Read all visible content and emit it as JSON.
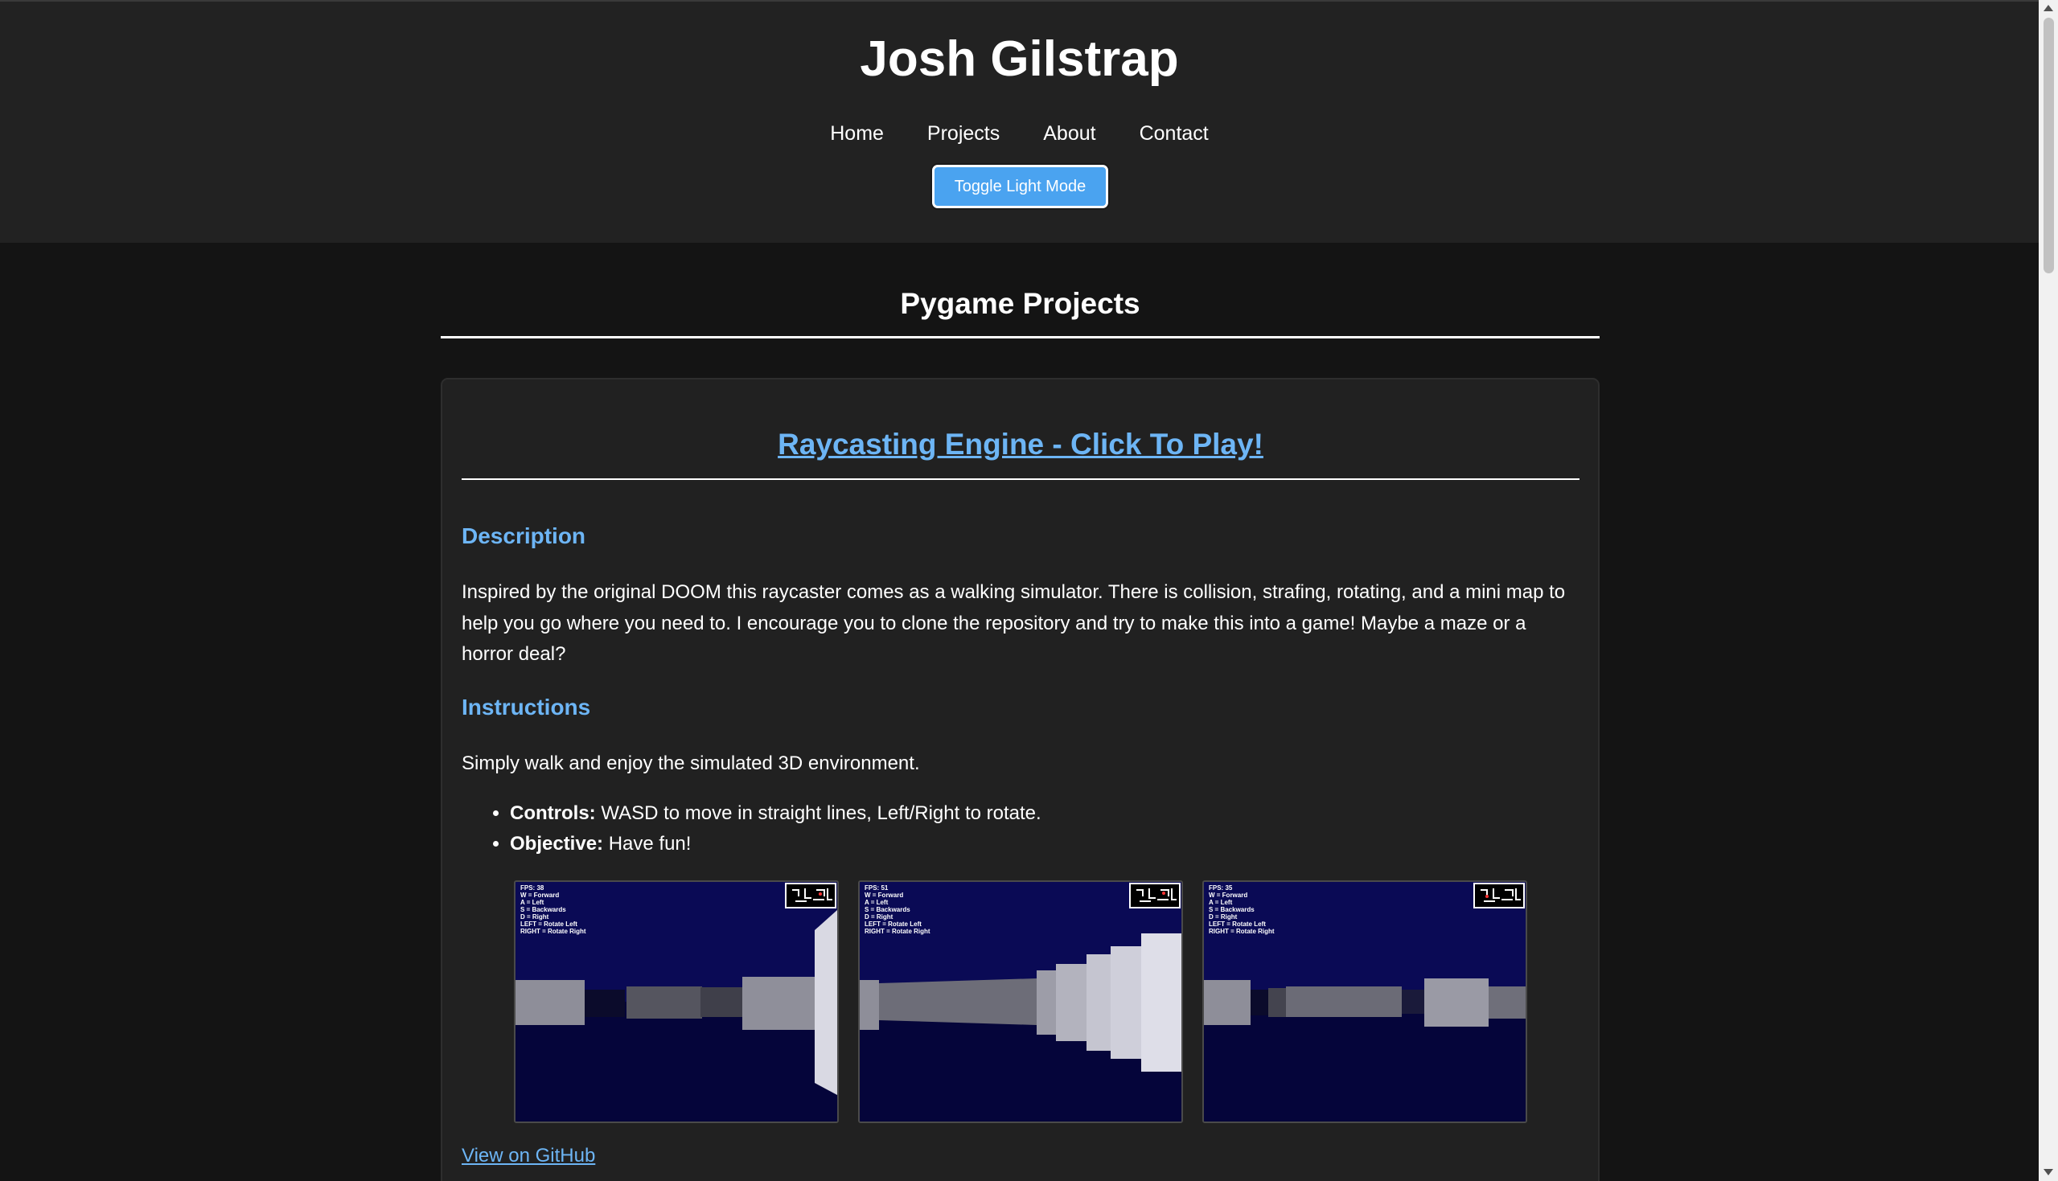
{
  "header": {
    "title": "Josh Gilstrap",
    "nav": [
      "Home",
      "Projects",
      "About",
      "Contact"
    ],
    "toggle_label": "Toggle Light Mode"
  },
  "main": {
    "section_title": "Pygame Projects",
    "project": {
      "title": "Raycasting Engine - Click To Play!",
      "description_heading": "Description",
      "description": "Inspired by the original DOOM this raycaster comes as a walking simulator. There is collision, strafing, rotating, and a mini map to help you go where you need to. I encourage you to clone the repository and try to make this into a game! Maybe a maze or a horror deal?",
      "instructions_heading": "Instructions",
      "instructions": "Simply walk and enjoy the simulated 3D environment.",
      "bullets": [
        {
          "label": "Controls:",
          "text": " WASD to move in straight lines, Left/Right to rotate."
        },
        {
          "label": "Objective:",
          "text": " Have fun!"
        }
      ],
      "screenshots": [
        {
          "fps": "FPS: 38"
        },
        {
          "fps": "FPS: 51"
        },
        {
          "fps": "FPS: 35"
        }
      ],
      "overlay_lines": [
        "W = Forward",
        "A = Left",
        "S = Backwards",
        "D = Right",
        "LEFT = Rotate Left",
        "RIGHT = Rotate Right"
      ],
      "github_link": "View on GitHub"
    }
  },
  "colors": {
    "page_bg": "#141414",
    "header_bg": "#222222",
    "card_bg": "#212121",
    "accent": "#6db5f5",
    "button": "#4aa3f0",
    "sky": "#0a0a55",
    "floor": "#05053a"
  }
}
